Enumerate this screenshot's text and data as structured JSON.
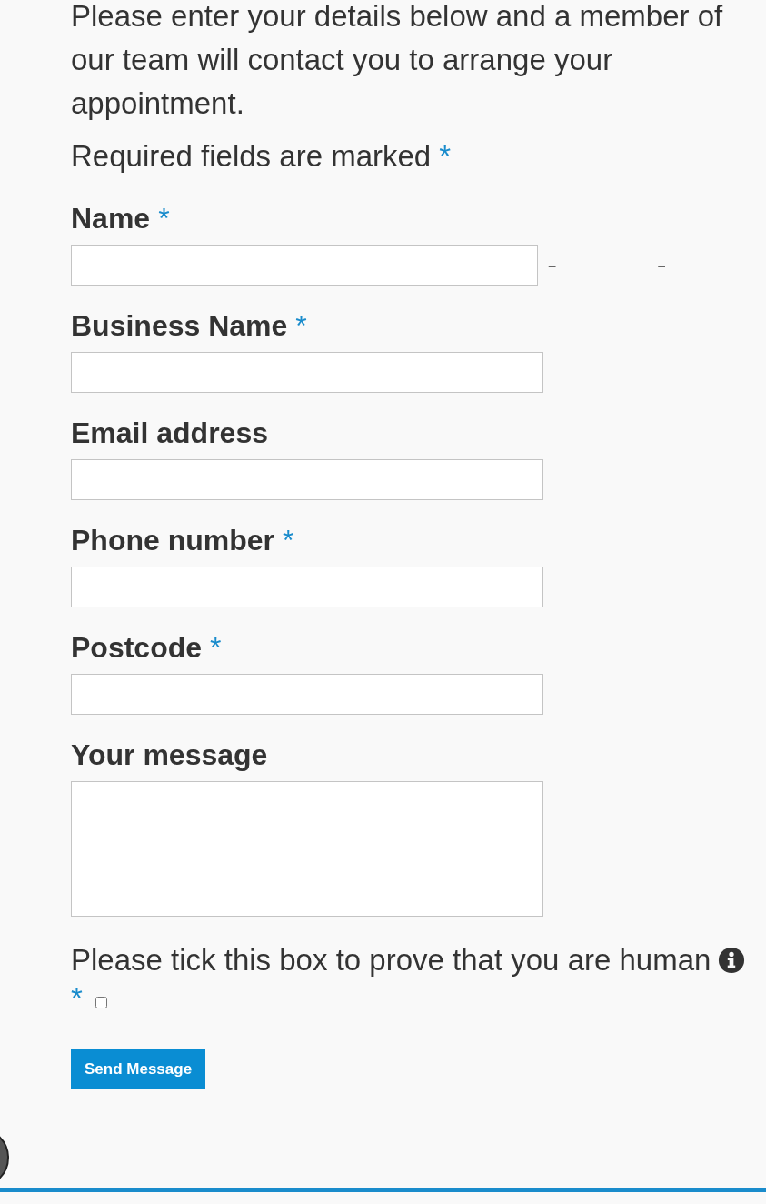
{
  "intro": "Please enter your details below and a member of our team will contact you to arrange your appointment.",
  "required_note": {
    "text": "Required fields are marked",
    "marker": "*"
  },
  "fields": [
    {
      "label": "Name",
      "required": true,
      "kind": "input",
      "side_marks": [
        "–",
        "–"
      ]
    },
    {
      "label": "Business Name",
      "required": true,
      "kind": "input"
    },
    {
      "label": "Email address",
      "required": false,
      "kind": "input"
    },
    {
      "label": "Phone number",
      "required": true,
      "kind": "input"
    },
    {
      "label": "Postcode",
      "required": true,
      "kind": "input"
    },
    {
      "label": "Your message",
      "required": false,
      "kind": "textarea"
    }
  ],
  "human_check": {
    "text": "Please tick this box to prove that you are human",
    "marker": "*",
    "checked": false
  },
  "submit": {
    "label": "Send Message"
  }
}
